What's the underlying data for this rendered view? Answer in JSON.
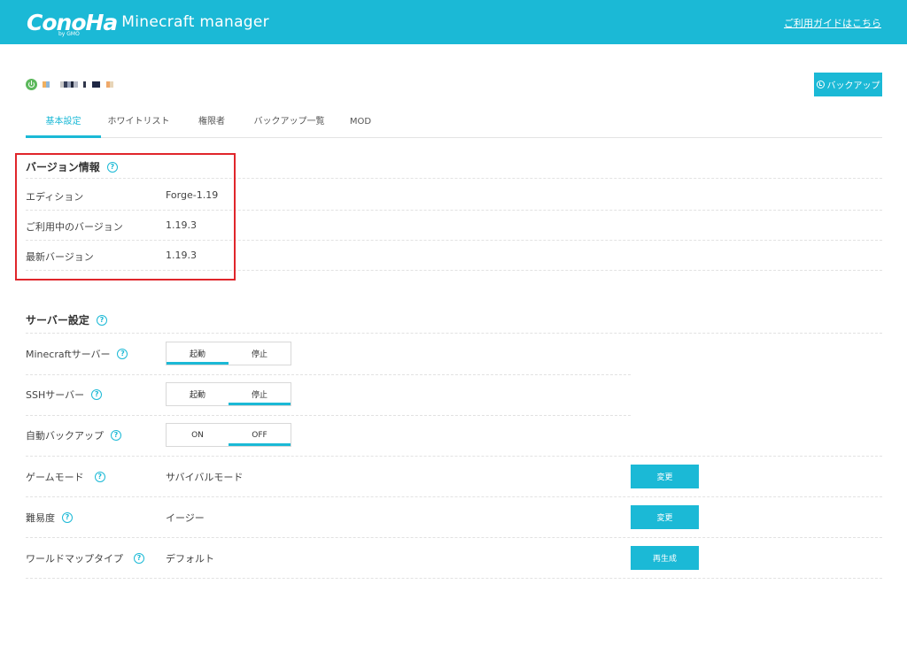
{
  "header": {
    "logo_text": "ConoHa",
    "logo_sub": "by GMO",
    "app_title": "Minecraft manager",
    "guide_link": "ご利用ガイドはこちら",
    "bg_color": "#1bb9d6"
  },
  "server": {
    "status_icon": "power-icon",
    "backup_button": "バックアップ"
  },
  "tabs": [
    {
      "label": "基本設定",
      "active": true
    },
    {
      "label": "ホワイトリスト",
      "active": false
    },
    {
      "label": "権限者",
      "active": false
    },
    {
      "label": "バックアップ一覧",
      "active": false
    },
    {
      "label": "MOD",
      "active": false
    }
  ],
  "version_info": {
    "title": "バージョン情報",
    "rows": [
      {
        "label": "エディション",
        "value": "Forge-1.19"
      },
      {
        "label": "ご利用中のバージョン",
        "value": "1.19.3"
      },
      {
        "label": "最新バージョン",
        "value": "1.19.3"
      }
    ]
  },
  "server_settings": {
    "title": "サーバー設定",
    "minecraft_server": {
      "label": "Minecraftサーバー",
      "options": [
        "起動",
        "停止"
      ],
      "selected": "起動"
    },
    "ssh_server": {
      "label": "SSHサーバー",
      "options": [
        "起動",
        "停止"
      ],
      "selected": "停止"
    },
    "auto_backup": {
      "label": "自動バックアップ",
      "options": [
        "ON",
        "OFF"
      ],
      "selected": "OFF"
    },
    "game_mode": {
      "label": "ゲームモード",
      "value": "サバイバルモード",
      "button": "変更"
    },
    "difficulty": {
      "label": "難易度",
      "value": "イージー",
      "button": "変更"
    },
    "world_map_type": {
      "label": "ワールドマップタイプ",
      "value": "デフォルト",
      "button": "再生成"
    }
  },
  "colors": {
    "accent": "#1bb9d6",
    "highlight": "#e0262b",
    "ok": "#5cb85c"
  }
}
